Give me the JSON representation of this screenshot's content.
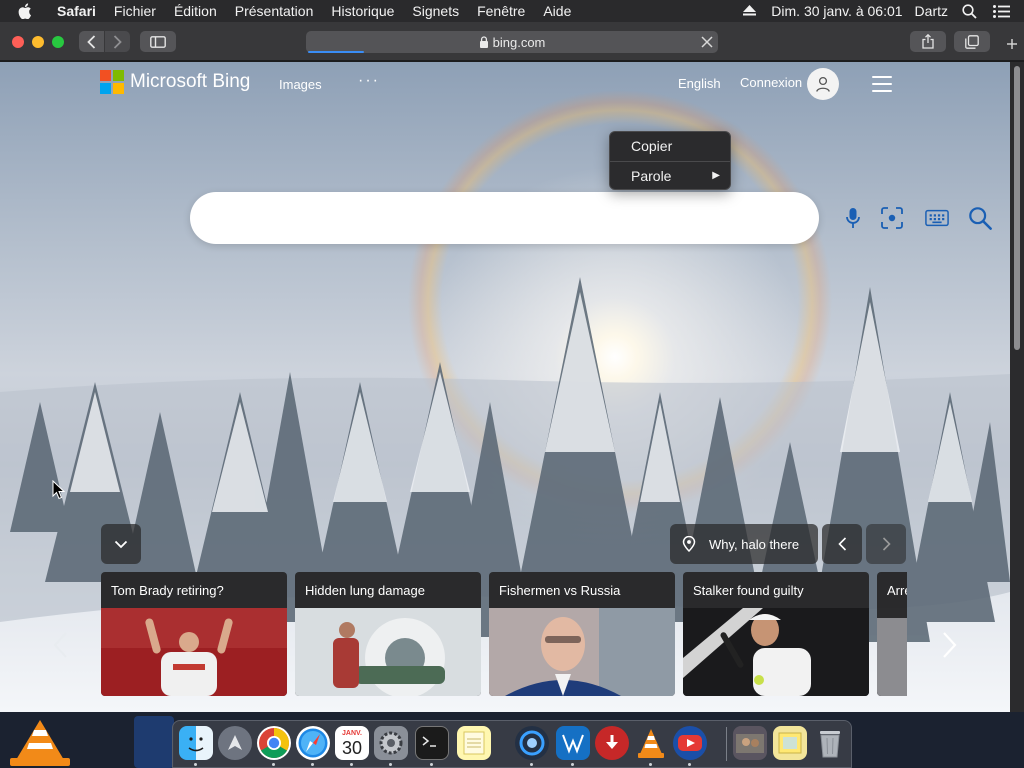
{
  "menubar": {
    "app": "Safari",
    "items": [
      "Fichier",
      "Édition",
      "Présentation",
      "Historique",
      "Signets",
      "Fenêtre",
      "Aide"
    ],
    "clock": "Dim. 30 janv. à 06:01",
    "user": "Dartz"
  },
  "toolbar": {
    "address": "bing.com"
  },
  "bing": {
    "brand": "Microsoft Bing",
    "nav_images": "Images",
    "nav_more": "···",
    "language": "English",
    "signin": "Connexion",
    "image_title": "Why, halo there"
  },
  "context_menu": {
    "copy": "Copier",
    "speech": "Parole",
    "speech_arrow": "▶"
  },
  "news": [
    {
      "title": "Tom Brady retiring?"
    },
    {
      "title": "Hidden lung damage"
    },
    {
      "title": "Fishermen vs Russia"
    },
    {
      "title": "Stalker found guilty"
    },
    {
      "title": "Arre"
    }
  ],
  "dock": {
    "calendar_month": "JANV.",
    "calendar_day": "30"
  },
  "colors": {
    "ms_red": "#f25022",
    "ms_green": "#7fba00",
    "ms_blue": "#00a4ef",
    "ms_yellow": "#ffb900",
    "bing_icon_blue": "#1a5fb4"
  }
}
